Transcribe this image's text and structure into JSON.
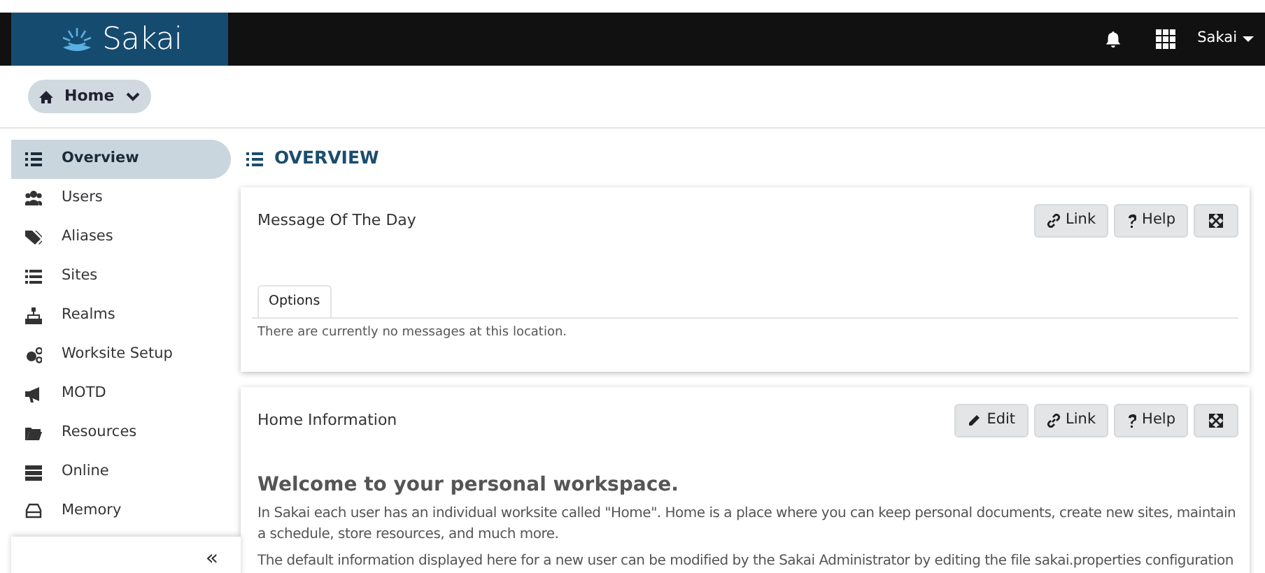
{
  "header": {
    "logo": "Sakai",
    "user_menu": "Sakai"
  },
  "breadcrumb": {
    "label": "Home"
  },
  "sidebar": {
    "items": [
      {
        "label": "Overview",
        "selected": true
      },
      {
        "label": "Users",
        "selected": false
      },
      {
        "label": "Aliases",
        "selected": false
      },
      {
        "label": "Sites",
        "selected": false
      },
      {
        "label": "Realms",
        "selected": false
      },
      {
        "label": "Worksite Setup",
        "selected": false
      },
      {
        "label": "MOTD",
        "selected": false
      },
      {
        "label": "Resources",
        "selected": false
      },
      {
        "label": "Online",
        "selected": false
      },
      {
        "label": "Memory",
        "selected": false
      }
    ],
    "collapse": "«"
  },
  "page_title": "OVERVIEW",
  "tools": [
    {
      "title": "Message Of The Day",
      "buttons": [
        {
          "kind": "link",
          "label": "Link"
        },
        {
          "kind": "help",
          "label": "Help"
        },
        {
          "kind": "expand"
        }
      ],
      "tabs": [
        {
          "label": "Options",
          "selected": true
        }
      ],
      "message": "There are currently no messages at this location."
    },
    {
      "title": "Home Information",
      "buttons": [
        {
          "kind": "edit",
          "label": "Edit"
        },
        {
          "kind": "link",
          "label": "Link"
        },
        {
          "kind": "help",
          "label": "Help"
        },
        {
          "kind": "expand"
        }
      ],
      "heading": "Welcome to your personal workspace.",
      "paragraphs": [
        "In Sakai each user has an individual worksite called \"Home\". Home is a place where you can keep personal documents, create new sites, maintain a schedule, store resources, and much more.",
        "The default information displayed here for a new user can be modified by the Sakai Administrator by editing the file sakai.properties configuration"
      ]
    }
  ]
}
